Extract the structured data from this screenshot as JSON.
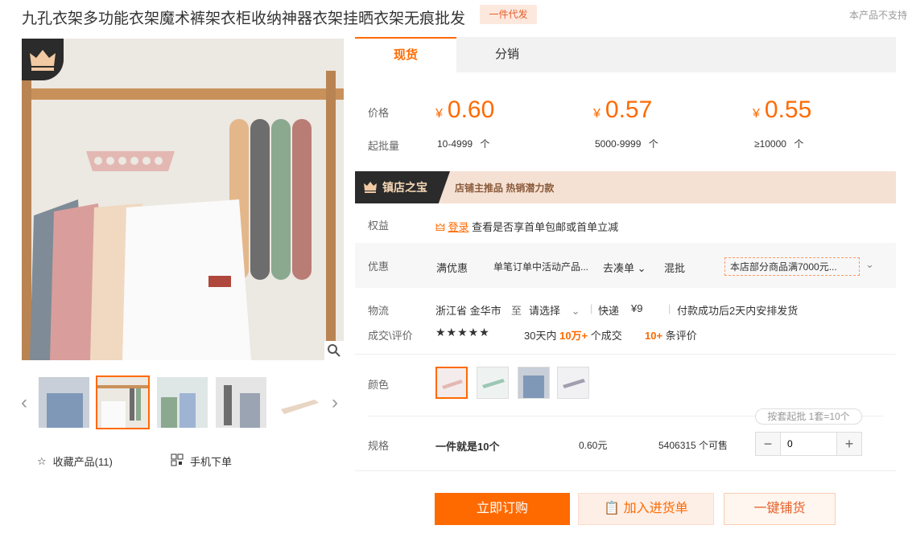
{
  "product": {
    "title": "九孔衣架多功能衣架魔术裤架衣柜收纳神器衣架挂晒衣架无痕批发",
    "badge": "一件代发",
    "note_right": "本产品不支持"
  },
  "gallery": {
    "thumb_count": 5,
    "active_thumb": 1,
    "favorite_label": "收藏产品(11)",
    "mobile_label": "手机下单"
  },
  "tabs": {
    "active": "现货",
    "other": "分销"
  },
  "pricing": {
    "price_label": "价格",
    "moq_label": "起批量",
    "tiers": [
      {
        "symbol": "¥",
        "price": "0.60",
        "range": "10-4999",
        "unit": "个"
      },
      {
        "symbol": "¥",
        "price": "0.57",
        "range": "5000-9999",
        "unit": "个"
      },
      {
        "symbol": "¥",
        "price": "0.55",
        "range": "≥10000",
        "unit": "个"
      }
    ]
  },
  "treasure": {
    "badge": "镇店之宝",
    "text": "店铺主推品  热销潜力款"
  },
  "rights": {
    "label": "权益",
    "login": "登录",
    "text": "查看是否享首单包邮或首单立减"
  },
  "promo": {
    "label": "优惠",
    "tag1": "满优惠",
    "desc1": "单笔订单中活动产品...",
    "link1": "去凑单",
    "tag2": "混批",
    "desc2": "本店部分商品满7000元..."
  },
  "logistics": {
    "label": "物流",
    "from": "浙江省 金华市",
    "to_word": "至",
    "select": "请选择",
    "express": "快递",
    "fee": "¥9",
    "ship_note": "付款成功后2天内安排发货"
  },
  "reviews": {
    "label": "成交\\评价",
    "stars": 5,
    "deals_prefix": "30天内",
    "deals_count": "10万+",
    "deals_suffix": "个成交",
    "review_count": "10+",
    "review_suffix": "条评价"
  },
  "color": {
    "label": "颜色",
    "swatches": [
      "粉色",
      "绿色",
      "图片",
      "灰色"
    ],
    "selected_index": 0
  },
  "spec": {
    "moq_chip": "按套起批  1套=10个",
    "label": "规格",
    "name": "一件就是10个",
    "price": "0.60元",
    "stock": "5406315 个可售",
    "quantity": "0"
  },
  "actions": {
    "buy": "立即订购",
    "cart": "加入进货单",
    "one_click": "一键铺货"
  },
  "colors": {
    "accent": "#ff6a00",
    "treasure_bg": "#f5e1d4"
  }
}
